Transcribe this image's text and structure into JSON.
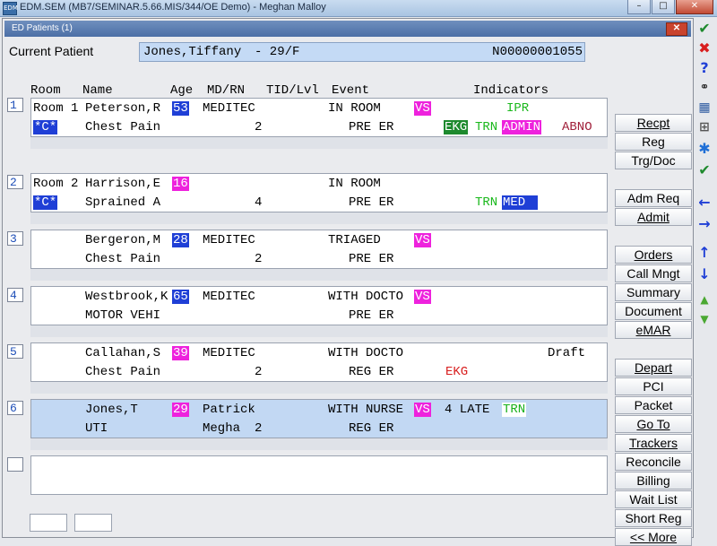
{
  "window": {
    "title": "EDM.SEM (MB7/SEMINAR.5.66.MIS/344/OE Demo) - Meghan Malloy",
    "app_icon": "EDM",
    "controls": [
      "–",
      "□",
      "✕"
    ]
  },
  "tab": {
    "title": "ED Patients (1)",
    "close_label": "✕"
  },
  "current_patient": {
    "label": "Current Patient",
    "name": "Jones,Tiffany",
    "age_sex": "- 29/F",
    "mrn": "N00000001055"
  },
  "columns": {
    "room": "Room",
    "name": "Name",
    "age": "Age",
    "mdrn": "MD/RN",
    "tid": "TID/Lvl",
    "event": "Event",
    "indicators": "Indicators"
  },
  "patients": [
    {
      "num": "1",
      "room": "Room 1",
      "name": "Peterson,R",
      "age": "53",
      "age_style": "blue",
      "md": "MEDITEC",
      "event": "IN ROOM",
      "vs": "VS",
      "ind1_extra": "IPR",
      "tag": "*C*",
      "complaint": "Chest Pain",
      "rn": "",
      "lvl": "2",
      "event2": "PRE ER",
      "ekg": "EKG",
      "trn": "TRN",
      "admin": "ADMIN",
      "abno": "ABNO"
    },
    {
      "num": "2",
      "room": "Room 2",
      "name": "Harrison,E",
      "age": "16",
      "age_style": "magenta",
      "md": "",
      "event": "IN ROOM",
      "tag": "*C*",
      "complaint": "Sprained A",
      "rn": "",
      "lvl": "4",
      "event2": "PRE ER",
      "trn": "TRN",
      "med": "MED"
    },
    {
      "num": "3",
      "room": "",
      "name": "Bergeron,M",
      "age": "28",
      "age_style": "blue",
      "md": "MEDITEC",
      "event": "TRIAGED",
      "vs": "VS",
      "complaint": "Chest Pain",
      "rn": "",
      "lvl": "2",
      "event2": "PRE ER"
    },
    {
      "num": "4",
      "room": "",
      "name": "Westbrook,K",
      "age": "65",
      "age_style": "blue",
      "md": "MEDITEC",
      "event": "WITH DOCTO",
      "vs": "VS",
      "complaint": "MOTOR VEHI",
      "rn": "",
      "lvl": "",
      "event2": "PRE ER"
    },
    {
      "num": "5",
      "room": "",
      "name": "Callahan,S",
      "age": "39",
      "age_style": "magenta",
      "md": "MEDITEC",
      "event": "WITH DOCTO",
      "draft": "Draft",
      "complaint": "Chest Pain",
      "rn": "",
      "lvl": "2",
      "event2": "REG ER",
      "ekg_red": "EKG"
    },
    {
      "num": "6",
      "room": "",
      "name": "Jones,T",
      "age": "29",
      "age_style": "magenta",
      "md": "Patrick",
      "event": "WITH NURSE",
      "vs": "VS",
      "late": "4 LATE",
      "trn_box": "TRN",
      "complaint": "UTI",
      "rn": "Megha",
      "lvl": "2",
      "event2": "REG ER"
    }
  ],
  "side_buttons": {
    "recpt": "Recpt",
    "reg": "Reg",
    "trg_doc": "Trg/Doc",
    "adm_req": "Adm Req",
    "admit": "Admit",
    "orders": "Orders",
    "call_mngt": "Call Mngt",
    "summary": "Summary",
    "document": "Document",
    "emar": "eMAR",
    "depart": "Depart",
    "pci": "PCI",
    "packet": "Packet",
    "go_to": "Go To",
    "trackers": "Trackers",
    "reconcile": "Reconcile",
    "billing": "Billing",
    "wait_list": "Wait List",
    "short_reg": "Short Reg",
    "more": "<< More"
  },
  "toolbar_icons": [
    "check-icon",
    "x-icon",
    "help-icon",
    "binoculars-icon",
    "table-icon",
    "tree-icon",
    "asterisk-icon",
    "check-all-icon",
    "arrow-left-icon",
    "arrow-right-icon",
    "arrow-up-icon",
    "arrow-down-icon",
    "double-up-icon",
    "double-down-icon"
  ],
  "colors": {
    "accent_blue": "#1f3fd6",
    "magenta": "#ee22dd",
    "green": "#1ab81c",
    "red": "#d81e1e",
    "selected_row": "#c2d8f3"
  }
}
